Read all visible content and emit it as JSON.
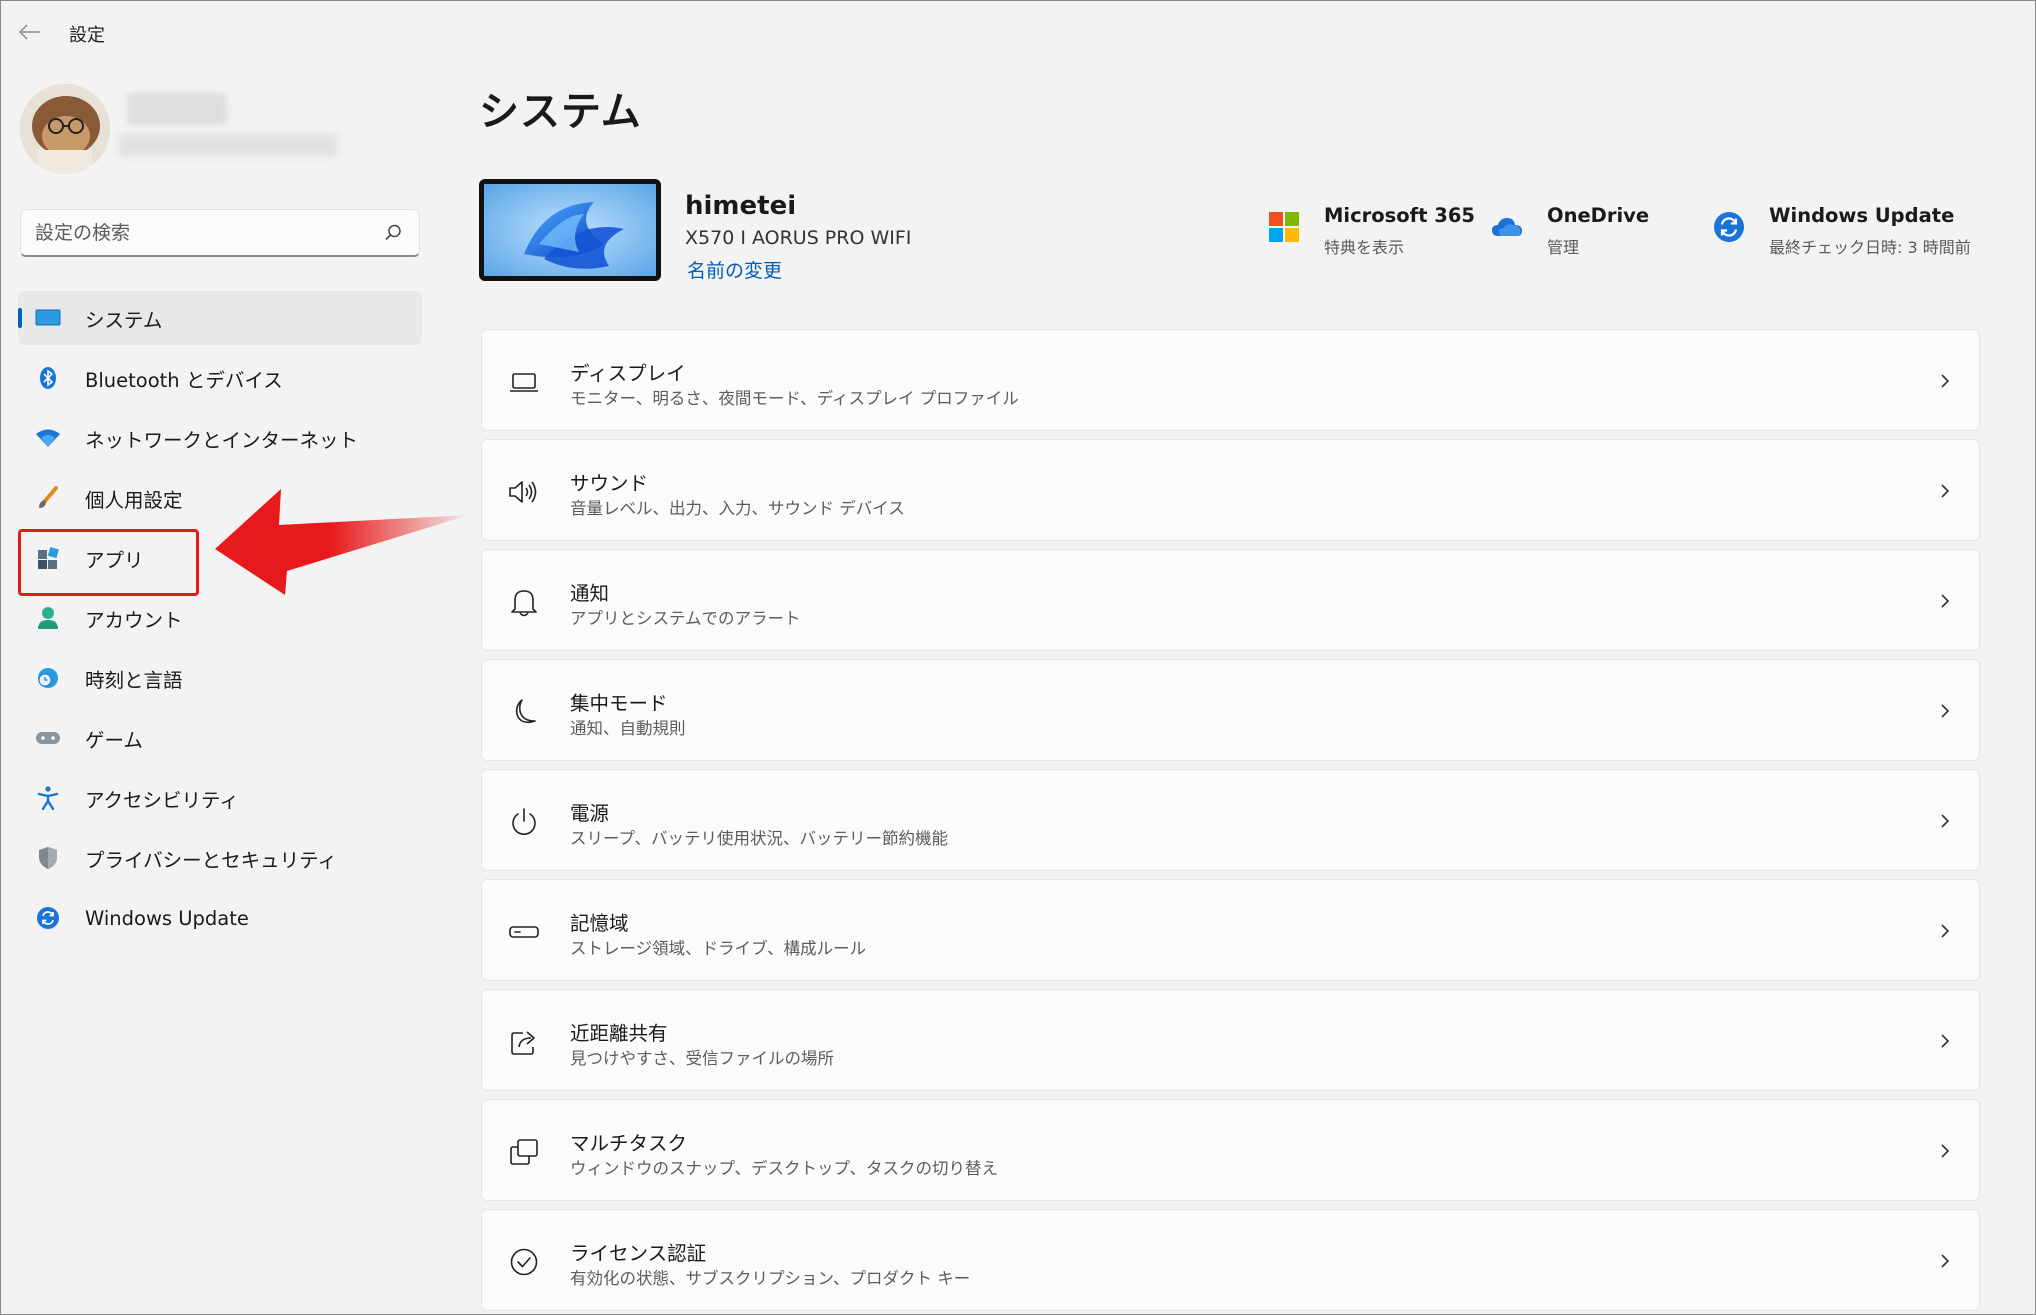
{
  "window": {
    "title": "設定"
  },
  "search": {
    "placeholder": "設定の検索"
  },
  "sidebar": {
    "items": [
      {
        "label": "システム",
        "icon": "monitor-icon",
        "selected": true
      },
      {
        "label": "Bluetooth とデバイス",
        "icon": "bluetooth-icon"
      },
      {
        "label": "ネットワークとインターネット",
        "icon": "wifi-icon"
      },
      {
        "label": "個人用設定",
        "icon": "brush-icon"
      },
      {
        "label": "アプリ",
        "icon": "apps-icon",
        "highlighted": true
      },
      {
        "label": "アカウント",
        "icon": "person-icon"
      },
      {
        "label": "時刻と言語",
        "icon": "clock-globe-icon"
      },
      {
        "label": "ゲーム",
        "icon": "gamepad-icon"
      },
      {
        "label": "アクセシビリティ",
        "icon": "accessibility-icon"
      },
      {
        "label": "プライバシーとセキュリティ",
        "icon": "shield-icon"
      },
      {
        "label": "Windows Update",
        "icon": "refresh-icon"
      }
    ]
  },
  "main": {
    "title": "システム",
    "device": {
      "name": "himetei",
      "model": "X570 I AORUS PRO WIFI",
      "rename_link": "名前の変更"
    },
    "quick_links": [
      {
        "title": "Microsoft 365",
        "subtitle": "特典を表示",
        "icon": "microsoft-logo-icon"
      },
      {
        "title": "OneDrive",
        "subtitle": "管理",
        "icon": "cloud-icon"
      },
      {
        "title": "Windows Update",
        "subtitle": "最終チェック日時: 3 時間前",
        "icon": "refresh-icon"
      }
    ],
    "cards": [
      {
        "title": "ディスプレイ",
        "desc": "モニター、明るさ、夜間モード、ディスプレイ プロファイル",
        "icon": "display-icon"
      },
      {
        "title": "サウンド",
        "desc": "音量レベル、出力、入力、サウンド デバイス",
        "icon": "speaker-icon"
      },
      {
        "title": "通知",
        "desc": "アプリとシステムでのアラート",
        "icon": "bell-icon"
      },
      {
        "title": "集中モード",
        "desc": "通知、自動規則",
        "icon": "moon-icon"
      },
      {
        "title": "電源",
        "desc": "スリープ、バッテリ使用状況、バッテリー節約機能",
        "icon": "power-icon"
      },
      {
        "title": "記憶域",
        "desc": "ストレージ領域、ドライブ、構成ルール",
        "icon": "storage-icon"
      },
      {
        "title": "近距離共有",
        "desc": "見つけやすさ、受信ファイルの場所",
        "icon": "share-icon"
      },
      {
        "title": "マルチタスク",
        "desc": "ウィンドウのスナップ、デスクトップ、タスクの切り替え",
        "icon": "multitask-icon"
      },
      {
        "title": "ライセンス認証",
        "desc": "有効化の状態、サブスクリプション、プロダクト キー",
        "icon": "check-circle-icon"
      }
    ]
  },
  "colors": {
    "accent": "#005fb8",
    "highlight": "#e8191c",
    "background": "#f3f3f3",
    "card": "#fbfbfb"
  }
}
